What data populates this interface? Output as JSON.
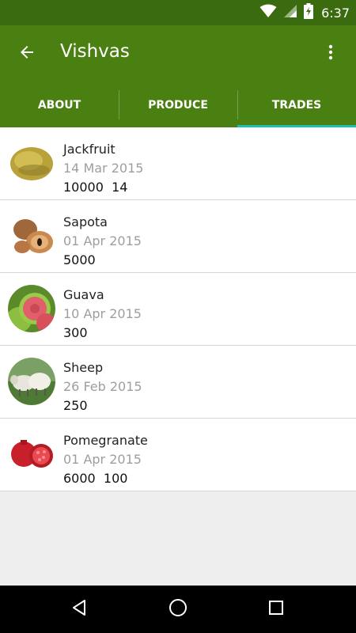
{
  "status_bar": {
    "time": "6:37",
    "icons": [
      "wifi-icon",
      "signal-icon",
      "battery-charging-icon"
    ]
  },
  "app_bar": {
    "title": "Vishvas",
    "back_icon": "arrow-left-icon",
    "menu_icon": "more-vert-icon"
  },
  "tabs": [
    {
      "label": "ABOUT",
      "active": false
    },
    {
      "label": "PRODUCE",
      "active": false
    },
    {
      "label": "TRADES",
      "active": true
    }
  ],
  "trades": [
    {
      "name": "Jackfruit",
      "date": "14 Mar 2015",
      "values": "10000  14",
      "image": "jackfruit"
    },
    {
      "name": "Sapota",
      "date": "01 Apr 2015",
      "values": "5000",
      "image": "sapota"
    },
    {
      "name": "Guava",
      "date": "10 Apr 2015",
      "values": "300",
      "image": "guava"
    },
    {
      "name": "Sheep",
      "date": "26 Feb 2015",
      "values": "250",
      "image": "sheep"
    },
    {
      "name": "Pomegranate",
      "date": "01 Apr 2015",
      "values": "6000  100",
      "image": "pomegranate"
    }
  ],
  "nav_bar": {
    "icons": [
      "back-triangle-icon",
      "home-circle-icon",
      "recents-square-icon"
    ]
  },
  "colors": {
    "status_bar": "#3b6b0f",
    "primary": "#4a7f11",
    "tab_indicator": "#1fbfb0",
    "secondary_text": "#9e9e9e"
  }
}
